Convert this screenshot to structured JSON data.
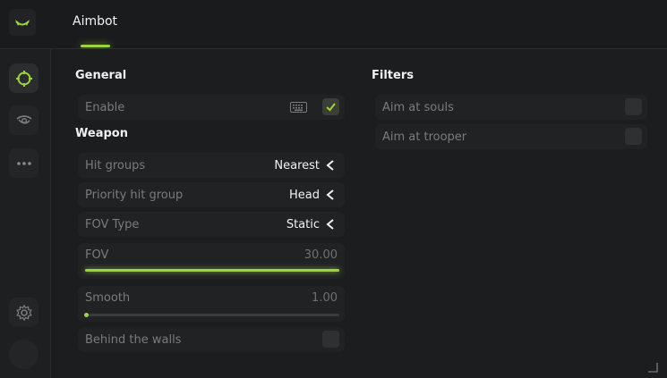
{
  "header": {
    "active_tab": "Aimbot"
  },
  "colors": {
    "accent": "#9ad63b",
    "background": "#1b1c1e",
    "panel": "#212224"
  },
  "sidebar": {
    "items": [
      {
        "icon": "crosshair-icon",
        "active": true
      },
      {
        "icon": "eye-icon",
        "active": false
      },
      {
        "icon": "more-dots-icon",
        "active": false
      }
    ],
    "bottom": [
      {
        "icon": "gear-icon"
      },
      {
        "icon": "avatar"
      }
    ]
  },
  "general": {
    "title": "General",
    "enable_label": "Enable",
    "enable_checked": true,
    "keybind_icon": "keyboard-icon"
  },
  "weapon": {
    "title": "Weapon",
    "hit_groups_label": "Hit groups",
    "hit_groups_value": "Nearest",
    "priority_label": "Priority hit group",
    "priority_value": "Head",
    "fov_type_label": "FOV Type",
    "fov_type_value": "Static",
    "fov_label": "FOV",
    "fov_value": "30.00",
    "fov_fill_percent": 100,
    "smooth_label": "Smooth",
    "smooth_value": "1.00",
    "smooth_fill_percent": 0,
    "behind_walls_label": "Behind the walls",
    "behind_walls_checked": false
  },
  "filters": {
    "title": "Filters",
    "souls_label": "Aim at souls",
    "souls_checked": false,
    "trooper_label": "Aim at trooper",
    "trooper_checked": false
  }
}
